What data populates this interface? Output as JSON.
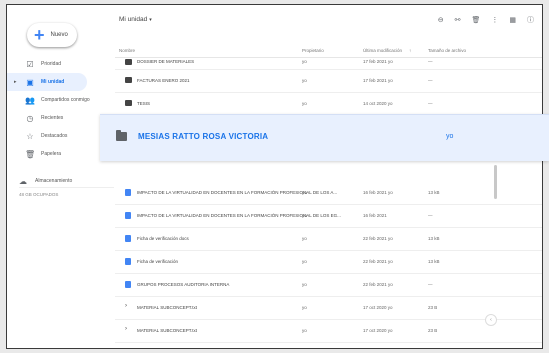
{
  "sidebar": {
    "new_label": "Nuevo",
    "items": [
      {
        "label": "Prioridad",
        "icon": "check-square-icon",
        "active": false
      },
      {
        "label": "Mi unidad",
        "icon": "drive-icon",
        "active": true
      },
      {
        "label": "Compartidos conmigo",
        "icon": "people-icon",
        "active": false
      },
      {
        "label": "Recientes",
        "icon": "clock-icon",
        "active": false
      },
      {
        "label": "Destacados",
        "icon": "star-icon",
        "active": false
      },
      {
        "label": "Papelera",
        "icon": "trash-icon",
        "active": false
      }
    ],
    "storage_label": "Almacenamiento",
    "storage_used": "48 GB OCUPADOS"
  },
  "header": {
    "breadcrumb": "Mi unidad",
    "columns": {
      "name": "Nombre",
      "owner": "Propietario",
      "modified": "Última modificación",
      "size": "Tamaño de archivo"
    }
  },
  "rows_top": [
    {
      "name": "DOSSIER DE MATERIALES",
      "owner": "yo",
      "modified": "17 feb 2021 yo",
      "size": "—",
      "type": "folder"
    },
    {
      "name": "FACTURAS ENERO 2021",
      "owner": "yo",
      "modified": "17 feb 2021 yo",
      "size": "—",
      "type": "folder"
    },
    {
      "name": "TESIS",
      "owner": "yo",
      "modified": "14 oct 2020 yo",
      "size": "—",
      "type": "folder"
    }
  ],
  "highlight": {
    "name": "MESIAS RATTO ROSA VICTORIA",
    "owner": "yo"
  },
  "rows_bottom": [
    {
      "name": "IMPACTO DE LA VIRTUALIDAD EN DOCENTES EN LA FORMACIÓN PROFESIONAL DE LOS A...",
      "owner": "yo",
      "modified": "16 feb 2021 yo",
      "size": "13 kB",
      "type": "doc"
    },
    {
      "name": "IMPACTO DE LA VIRTUALIDAD EN DOCENTES EN LA FORMACIÓN PROFESIONAL DE LOS EG...",
      "owner": "yo",
      "modified": "16 feb 2021",
      "size": "—",
      "type": "doc"
    },
    {
      "name": "Ficha de verificación docs",
      "owner": "yo",
      "modified": "22 feb 2021 yo",
      "size": "13 kB",
      "type": "doc"
    },
    {
      "name": "Ficha de verificación",
      "owner": "yo",
      "modified": "22 feb 2021 yo",
      "size": "13 kB",
      "type": "doc"
    },
    {
      "name": "GRUPOS PROCESOS AUDITORIA INTERNA",
      "owner": "yo",
      "modified": "22 feb 2021 yo",
      "size": "—",
      "type": "doc"
    },
    {
      "name": "MATERIAL SUBCONCEPT.txt",
      "owner": "yo",
      "modified": "17 oct 2020 yo",
      "size": "23 B",
      "type": "shortcut"
    },
    {
      "name": "MATERIAL SUBCONCEPT.txt",
      "owner": "yo",
      "modified": "17 oct 2020 yo",
      "size": "23 B",
      "type": "shortcut"
    }
  ]
}
